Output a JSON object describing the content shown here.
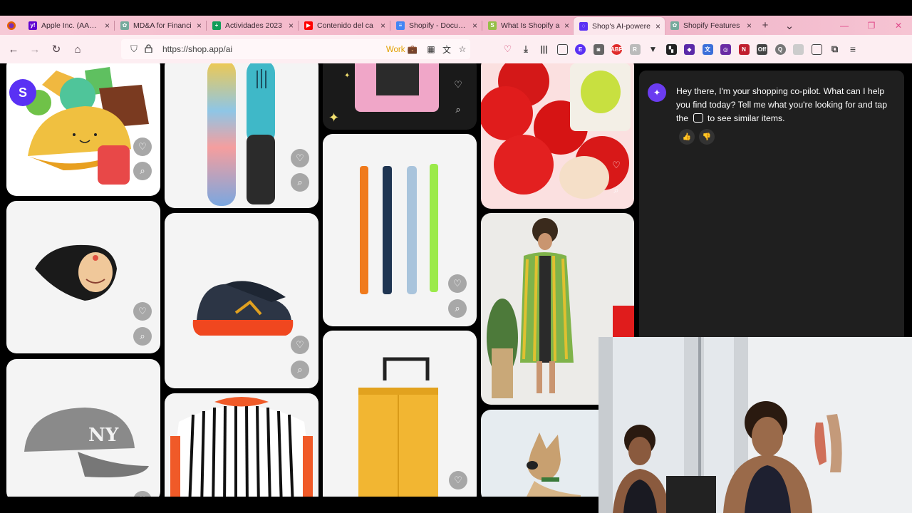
{
  "browser": {
    "tabs": [
      {
        "label": "Apple Inc. (AAPL)",
        "fav_color": "#5f01d1",
        "fav_glyph": "y!"
      },
      {
        "label": "MD&A for Financi",
        "fav_color": "#74aa9c",
        "fav_glyph": "✿"
      },
      {
        "label": "Actividades 2023",
        "fav_color": "#0f9d58",
        "fav_glyph": "+"
      },
      {
        "label": "Contenido del ca",
        "fav_color": "#ff0000",
        "fav_glyph": "▶"
      },
      {
        "label": "Shopify - Docume",
        "fav_color": "#4285f4",
        "fav_glyph": "≡"
      },
      {
        "label": "What Is Shopify a",
        "fav_color": "#95bf47",
        "fav_glyph": "S"
      },
      {
        "label": "Shop's AI-powere",
        "fav_color": "#5a31f4",
        "fav_glyph": "◌"
      },
      {
        "label": "Shopify Features",
        "fav_color": "#74aa9c",
        "fav_glyph": "✿"
      }
    ],
    "active_tab": 6,
    "url": "https://shop.app/ai",
    "work_badge": "Work"
  },
  "colors": {
    "tab_strip": "#f3b7c9",
    "nav_bar": "#fdeef2",
    "chat_bg": "#1f1f1f",
    "shop_purple": "#5a31f4"
  },
  "chat": {
    "message_part1": "Hey there, I'm your shopping co-pilot. What can I help you find today? Tell me what you're looking for and tap the",
    "message_part2": "to see similar items.",
    "like_icon": "thumbs-up-icon",
    "dislike_icon": "thumbs-down-icon"
  },
  "products": [
    {
      "name": "plush-taco-toys"
    },
    {
      "name": "gradient-snowboards"
    },
    {
      "name": "face-mask-pack"
    },
    {
      "name": "red-apple-lip-balm"
    },
    {
      "name": "face-enamel-pin"
    },
    {
      "name": "colorful-candles"
    },
    {
      "name": "navy-orange-sneakers"
    },
    {
      "name": "striped-robe-model"
    },
    {
      "name": "gray-ny-cap"
    },
    {
      "name": "striped-sweater"
    },
    {
      "name": "yellow-suitcase"
    },
    {
      "name": "dog-photo"
    }
  ]
}
